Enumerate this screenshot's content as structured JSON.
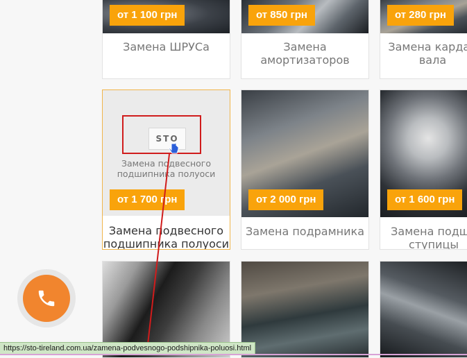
{
  "cards": [
    {
      "price": "от 1 100 грн",
      "title": "Замена ШРУСа"
    },
    {
      "price": "от 850 грн",
      "title": "Замена амортизаторов"
    },
    {
      "price": "от 280 грн",
      "title_line1": "Замена кардан",
      "title_line2": "вала"
    },
    {
      "price": "от 1 700 грн",
      "title_line1": "Замена подвесного",
      "title_line2": "подшипника полуоси",
      "placeholder_logo": "STO",
      "placeholder_line1": "Замена подвесного",
      "placeholder_line2": "подшипника полуоси"
    },
    {
      "price": "от 2 000 грн",
      "title": "Замена подрамника"
    },
    {
      "price": "от 1 600 грн",
      "title_line1": "Замена подши",
      "title_line2": "ступицы"
    }
  ],
  "call_button": {
    "icon": "phone-icon",
    "color": "#f1852e"
  },
  "status_bar": {
    "url": "https://sto-tireland.com.ua/zamena-podvesnogo-podshipnika-poluosi.html"
  },
  "colors": {
    "accent": "#f9a30b",
    "annotation": "#d01c1c"
  }
}
